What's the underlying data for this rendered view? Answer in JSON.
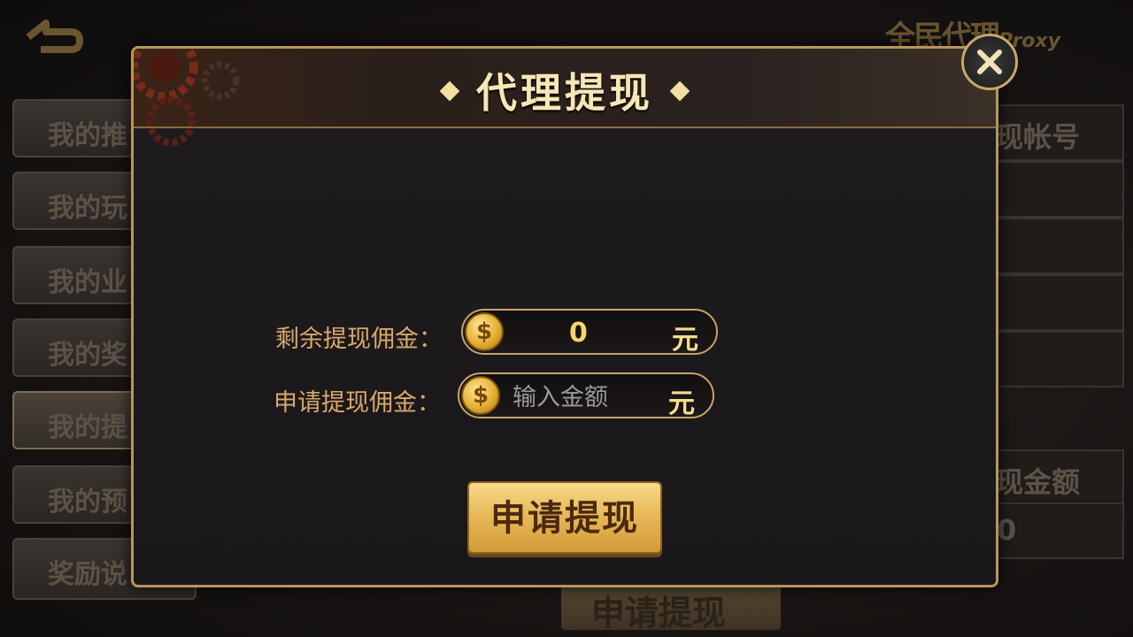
{
  "background": {
    "logo_text": "全民代理",
    "logo_sub": "Proxy",
    "sidebar": [
      {
        "label": "我的推"
      },
      {
        "label": "我的玩"
      },
      {
        "label": "我的业"
      },
      {
        "label": "我的奖"
      },
      {
        "label": "我的提"
      },
      {
        "label": "我的预"
      },
      {
        "label": "奖励说"
      }
    ],
    "right_column": {
      "account_header": "现帐号",
      "amount_header": "现金额",
      "amount_value": "0"
    },
    "apply_label": "申请提现"
  },
  "dialog": {
    "title": "代理提现",
    "remaining": {
      "label": "剩余提现佣金：",
      "value": "0",
      "unit": "元",
      "coin": "$"
    },
    "request": {
      "label": "申请提现佣金：",
      "placeholder": "输入金额",
      "unit": "元",
      "coin": "$"
    },
    "apply_button": "申请提现",
    "close_icon": "close-icon"
  },
  "colors": {
    "accent_gold": "#d9a86a",
    "title": "#f7e7b6",
    "border": "#b8955a"
  }
}
